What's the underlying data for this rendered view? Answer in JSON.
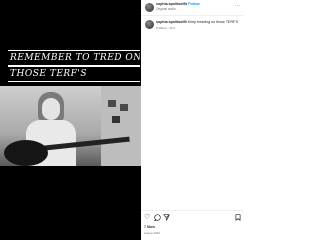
{
  "media": {
    "caption_line1": "REMEMBER TO TRED ON",
    "caption_line2": "THOSE TERF'S"
  },
  "header": {
    "username": "sophia.spolitsolfit",
    "follow_label": "• Follow",
    "subtitle": "Original audio",
    "more_icon": "more-icon"
  },
  "comment": {
    "username": "sophia.spolitsolfit",
    "text": " Keep treading on those TERF'S",
    "meta": "8 Wlleol · 26 d"
  },
  "actions": {
    "icons": [
      "heart-icon",
      "comment-icon",
      "share-icon",
      "save-icon"
    ],
    "likes": "7 likes",
    "date": "Aoaya 2022"
  }
}
